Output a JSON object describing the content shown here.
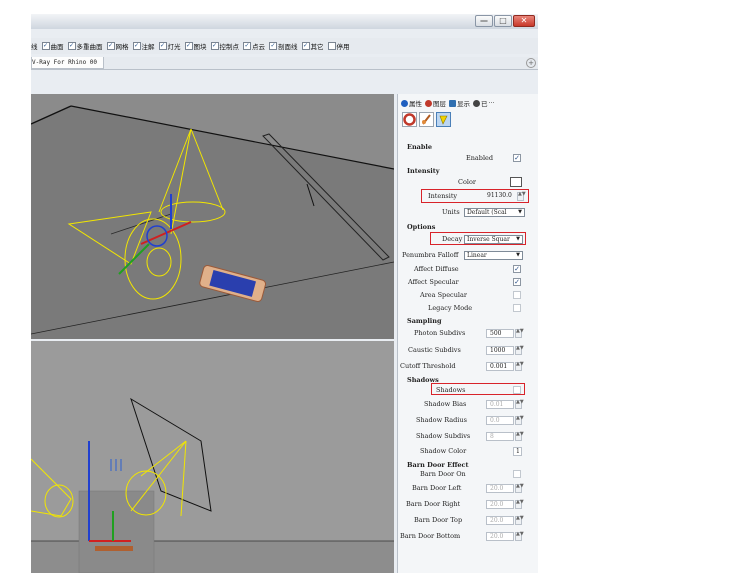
{
  "titlebar": {
    "buttons": [
      "—",
      "□",
      "✕"
    ]
  },
  "filters": [
    {
      "label": "线",
      "checked": true
    },
    {
      "label": "曲面",
      "checked": true
    },
    {
      "label": "多重曲面",
      "checked": true
    },
    {
      "label": "网格",
      "checked": true
    },
    {
      "label": "注解",
      "checked": true
    },
    {
      "label": "灯光",
      "checked": true
    },
    {
      "label": "图块",
      "checked": true
    },
    {
      "label": "控制点",
      "checked": true
    },
    {
      "label": "点云",
      "checked": true
    },
    {
      "label": "剖面线",
      "checked": true
    },
    {
      "label": "其它",
      "checked": true
    },
    {
      "label": "停用",
      "checked": false
    }
  ],
  "viewport_tab": {
    "label": "V-Ray For Rhino 00",
    "plus": "+"
  },
  "panel": {
    "tabs": [
      {
        "label": "属性",
        "color": "#1f5fbf"
      },
      {
        "label": "图层",
        "color": "#c0392b"
      },
      {
        "label": "显示",
        "color": "#2f6fb0"
      },
      {
        "label": "已",
        "color": "#444444"
      }
    ],
    "tab_more": "···",
    "enable": {
      "section": "Enable",
      "enabled_label": "Enabled",
      "enabled": true
    },
    "intensity": {
      "section": "Intensity",
      "color_label": "Color",
      "color": "#ffffff",
      "intensity_label": "Intensity",
      "intensity_value": "91130.0",
      "units_label": "Units",
      "units_value": "Default (Scal"
    },
    "options": {
      "section": "Options",
      "decay_label": "Decay",
      "decay_value": "Inverse Squar",
      "penumbra_label": "Penumbra Falloff",
      "penumbra_value": "Linear",
      "affect_diffuse_label": "Affect Diffuse",
      "affect_diffuse": true,
      "affect_specular_label": "Affect Specular",
      "affect_specular": true,
      "area_specular_label": "Area Specular",
      "area_specular": false,
      "legacy_mode_label": "Legacy Mode",
      "legacy_mode": false
    },
    "sampling": {
      "section": "Sampling",
      "photon_label": "Photon Subdivs",
      "photon_value": "500",
      "caustic_label": "Caustic Subdivs",
      "caustic_value": "1000",
      "cutoff_label": "Cutoff Threshold",
      "cutoff_value": "0.001"
    },
    "shadows": {
      "section": "Shadows",
      "shadows_label": "Shadows",
      "shadows": false,
      "bias_label": "Shadow Bias",
      "bias_value": "0.01",
      "radius_label": "Shadow Radius",
      "radius_value": "0.0",
      "subdivs_label": "Shadow Subdivs",
      "subdivs_value": "8",
      "color_label": "Shadow Color",
      "color_value": "1"
    },
    "barn_door": {
      "section": "Barn Door Effect",
      "on_label": "Barn Door On",
      "on": false,
      "left_label": "Barn Door Left",
      "left_value": "20.0",
      "right_label": "Barn Door Right",
      "right_value": "20.0",
      "top_label": "Barn Door Top",
      "top_value": "20.0",
      "bottom_label": "Barn Door Bottom",
      "bottom_value": "20.0"
    }
  },
  "colors": {
    "highlight": "#d8232a",
    "light_gizmo": "#f2e600",
    "axis_x": "#d02020",
    "axis_y": "#20a020",
    "axis_z": "#2040d0"
  }
}
